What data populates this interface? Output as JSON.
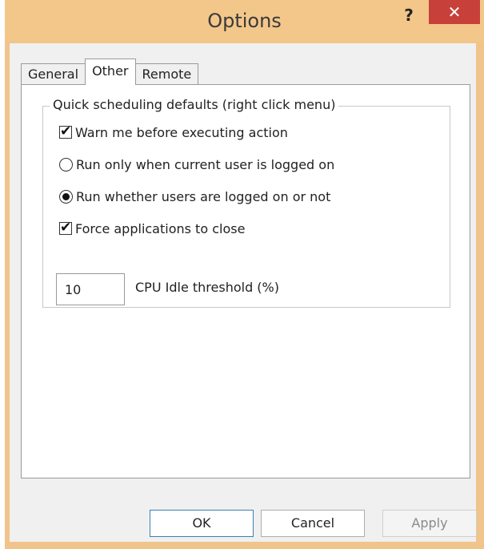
{
  "window": {
    "title": "Options",
    "help_glyph": "?",
    "close_glyph": "✕"
  },
  "tabs": [
    {
      "label": "General",
      "active": false
    },
    {
      "label": "Other",
      "active": true
    },
    {
      "label": "Remote",
      "active": false
    }
  ],
  "group": {
    "legend": "Quick scheduling defaults (right click menu)",
    "options": [
      {
        "type": "checkbox",
        "label": "Warn me before executing action",
        "checked": true
      },
      {
        "type": "radio",
        "label": "Run only when current user is logged on",
        "checked": false
      },
      {
        "type": "radio",
        "label": "Run whether users are logged on or not",
        "checked": true
      },
      {
        "type": "checkbox",
        "label": "Force applications to close",
        "checked": true
      }
    ],
    "cpu_idle": {
      "value": "10",
      "label": "CPU Idle threshold (%)"
    }
  },
  "buttons": {
    "ok": "OK",
    "cancel": "Cancel",
    "apply": "Apply"
  },
  "colors": {
    "titlebar": "#f3c68a",
    "close": "#c7403a",
    "default_button_border": "#3c7fb1"
  }
}
